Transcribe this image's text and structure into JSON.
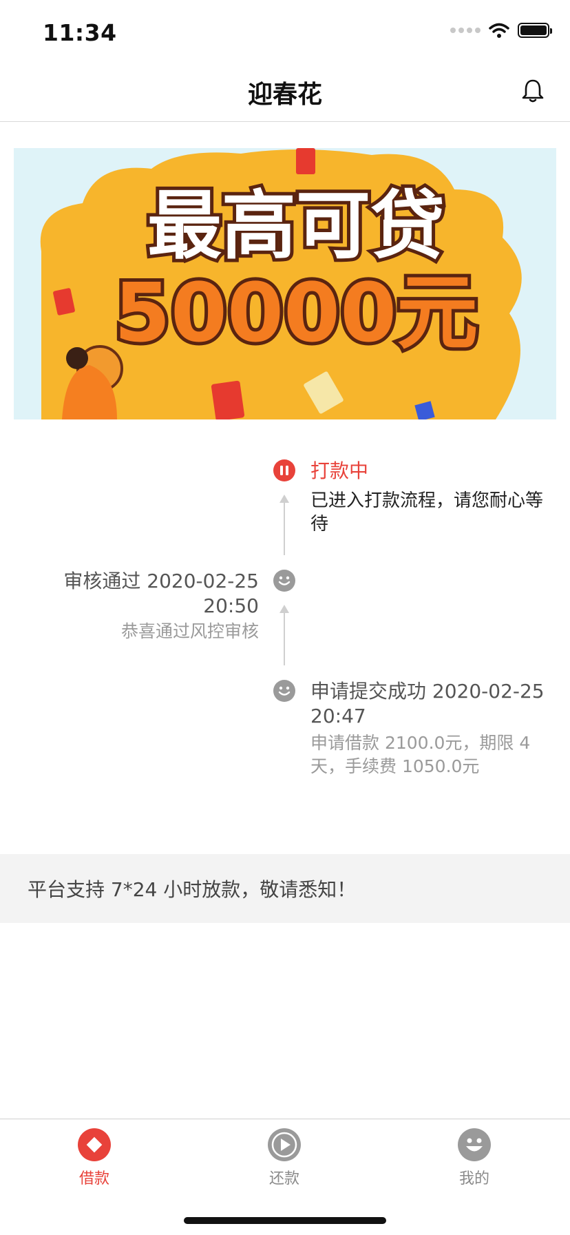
{
  "status_bar": {
    "time": "11:34"
  },
  "nav": {
    "title": "迎春花"
  },
  "banner": {
    "headline": "最高可贷",
    "amount": "50000元"
  },
  "timeline": [
    {
      "title": "打款中",
      "desc": "已进入打款流程，请您耐心等待",
      "status_icon": "pause-icon",
      "side": "right",
      "color": "#e8423a"
    },
    {
      "title": "审核通过 2020-02-25 20:50",
      "desc": "恭喜通过风控审核",
      "status_icon": "smile-icon",
      "side": "left"
    },
    {
      "title": "申请提交成功 2020-02-25 20:47",
      "desc": "申请借款 2100.0元，期限 4 天，手续费 1050.0元",
      "status_icon": "smile-icon",
      "side": "right"
    }
  ],
  "notice": {
    "text": "平台支持 7*24 小时放款，敬请悉知！"
  },
  "tabs": [
    {
      "label": "借款",
      "icon": "diamond-icon",
      "active": true
    },
    {
      "label": "还款",
      "icon": "play-icon",
      "active": false
    },
    {
      "label": "我的",
      "icon": "smile-icon",
      "active": false
    }
  ],
  "colors": {
    "accent": "#e8423a",
    "inactive": "#9a9a9a",
    "banner_bg": "#f7b52c"
  }
}
